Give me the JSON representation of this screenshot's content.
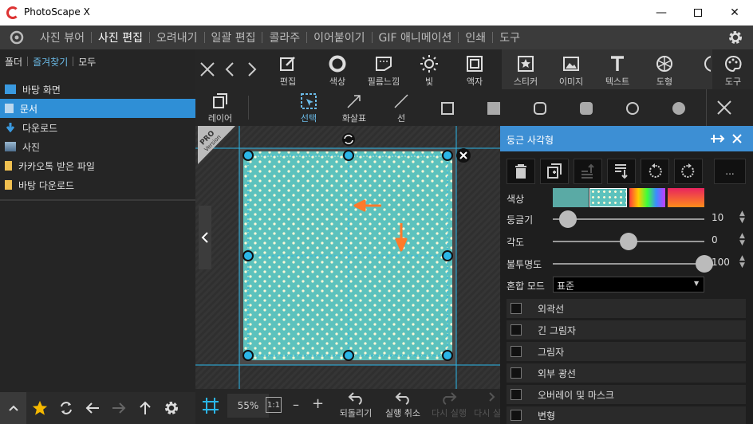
{
  "window": {
    "title": "PhotoScape X"
  },
  "nav": {
    "items": [
      "사진 뷰어",
      "사진 편집",
      "오려내기",
      "일괄 편집",
      "콜라주",
      "이어붙이기",
      "GIF 애니메이션",
      "인쇄",
      "도구"
    ],
    "active_index": 1
  },
  "left_panel": {
    "tabs": [
      "폴더",
      "즐겨찾기",
      "모두"
    ],
    "active_tab": 1,
    "folders": [
      {
        "label": "바탕 화면",
        "icon": "desktop-icon",
        "color": "#3a9ae0"
      },
      {
        "label": "문서",
        "icon": "document-icon",
        "color": "#bcd8ee"
      },
      {
        "label": "다운로드",
        "icon": "download-icon",
        "color": "#3a9ae0"
      },
      {
        "label": "사진",
        "icon": "picture-icon",
        "color": "#9ab8d0"
      },
      {
        "label": "카카오톡 받은 파일",
        "icon": "folder-icon",
        "color": "#f0c050"
      },
      {
        "label": "바탕 다운로드",
        "icon": "folder-icon",
        "color": "#f0c050"
      }
    ],
    "selected_folder": 1
  },
  "toolbar_top": {
    "tools": [
      {
        "label": "편집",
        "icon": "edit-icon"
      },
      {
        "label": "색상",
        "icon": "color-circle-icon"
      },
      {
        "label": "필름느낌",
        "icon": "film-icon"
      },
      {
        "label": "빛",
        "icon": "sun-icon"
      },
      {
        "label": "액자",
        "icon": "frame-icon"
      },
      {
        "label": "스티커",
        "icon": "sticker-icon"
      },
      {
        "label": "이미지",
        "icon": "image-icon"
      },
      {
        "label": "텍스트",
        "icon": "text-icon"
      },
      {
        "label": "도형",
        "icon": "shape-icon"
      },
      {
        "label": "도구",
        "icon": "palette-icon"
      }
    ]
  },
  "toolbar_second": {
    "tools": [
      {
        "label": "레이어",
        "icon": "layers-icon"
      },
      {
        "label": "선택",
        "icon": "select-icon"
      },
      {
        "label": "화살표",
        "icon": "arrow-icon"
      },
      {
        "label": "선",
        "icon": "line-icon"
      }
    ]
  },
  "canvas": {
    "badge_main": "PRO",
    "badge_sub": "Version",
    "pattern_color": "#5cc2bd"
  },
  "bottom_bar": {
    "zoom": "55%",
    "fit_label": "1:1",
    "actions": [
      "되돌리기",
      "실행 취소",
      "다시 실행",
      "다시 실"
    ]
  },
  "right_panel": {
    "title": "둥근 사각형",
    "rows": [
      {
        "label": "색상"
      },
      {
        "label": "둥글기",
        "value": "10",
        "fraction": 0.1
      },
      {
        "label": "각도",
        "value": "0",
        "fraction": 0.5
      },
      {
        "label": "불투명도",
        "value": "100",
        "fraction": 1.0
      }
    ],
    "blend_label": "혼합 모드",
    "blend_value": "표준",
    "more_label": "...",
    "checkboxes": [
      "외곽선",
      "긴 그림자",
      "그림자",
      "외부 광선",
      "오버레이 및 마스크",
      "변형"
    ]
  }
}
